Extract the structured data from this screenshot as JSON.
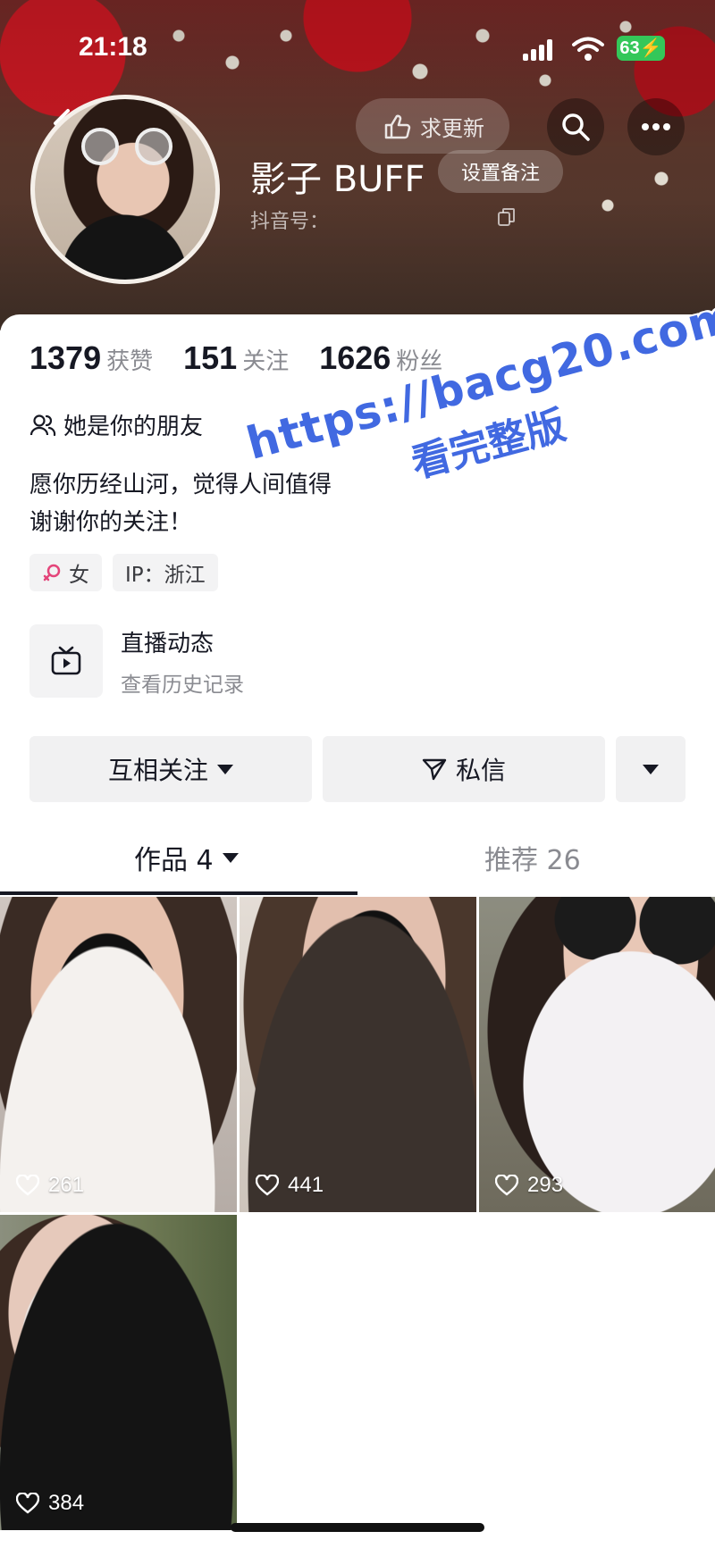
{
  "status_bar": {
    "time": "21:18",
    "battery": "63"
  },
  "profile": {
    "nickname": "影子 BUFF",
    "remark_label": "设置备注",
    "douyin_id_label": "抖音号：",
    "update_label": "求更新"
  },
  "stats": {
    "likes": {
      "value": "1379",
      "label": "获赞"
    },
    "following": {
      "value": "151",
      "label": "关注"
    },
    "followers": {
      "value": "1626",
      "label": "粉丝"
    }
  },
  "friend_text": "她是你的朋友",
  "bio": {
    "line1": "愿你历经山河，觉得人间值得",
    "line2": "谢谢你的关注！"
  },
  "tags": {
    "gender": "女",
    "ip": "IP：浙江"
  },
  "live": {
    "title": "直播动态",
    "subtitle": "查看历史记录"
  },
  "actions": {
    "follow": "互相关注",
    "message": "私信"
  },
  "tabs": {
    "works_label": "作品 4",
    "recommend_label": "推荐 26"
  },
  "videos": [
    {
      "likes": "261"
    },
    {
      "likes": "441"
    },
    {
      "likes": "293"
    },
    {
      "likes": "384"
    }
  ],
  "watermark": {
    "url": "https://bacg20.com",
    "text": "看完整版"
  },
  "colors": {
    "accent_gender": "#e4457a",
    "watermark": "#4169e1",
    "battery": "#34c759"
  }
}
